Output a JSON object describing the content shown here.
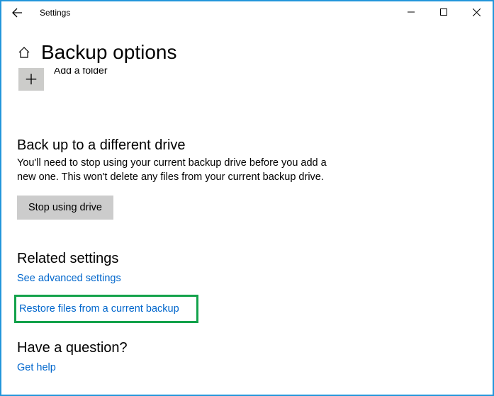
{
  "titlebar": {
    "app_name": "Settings"
  },
  "header": {
    "page_title": "Backup options"
  },
  "add_folder": {
    "label": "Add a folder"
  },
  "backup_section": {
    "heading": "Back up to a different drive",
    "description": "You'll need to stop using your current backup drive before you add a new one. This won't delete any files from your current backup drive.",
    "button_label": "Stop using drive"
  },
  "related": {
    "heading": "Related settings",
    "link_advanced": "See advanced settings",
    "link_restore": "Restore files from a current backup"
  },
  "question": {
    "heading": "Have a question?",
    "link_help": "Get help"
  }
}
